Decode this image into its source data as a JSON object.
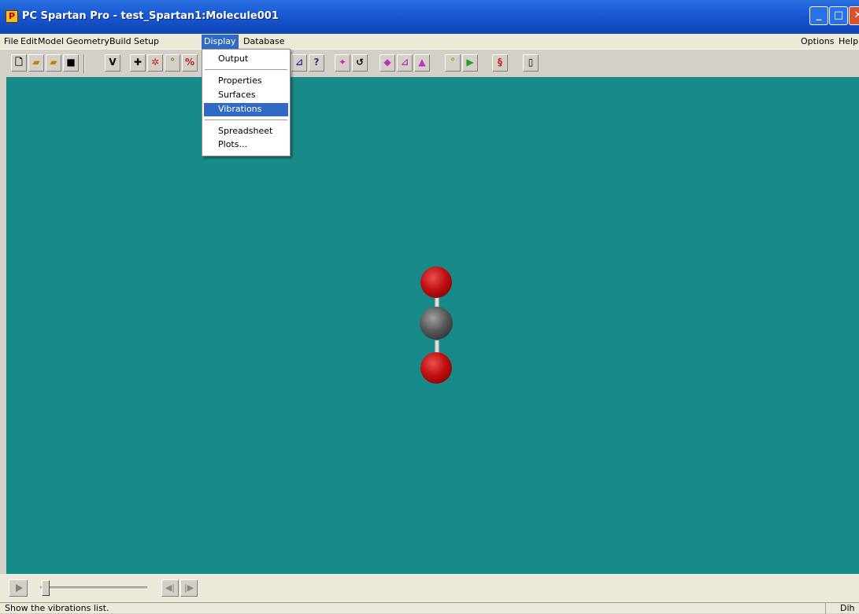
{
  "window": {
    "app_icon": "spartan-logo-icon",
    "title": "PC Spartan Pro - test_Spartan1:Molecule001",
    "minimize_icon": "minimize-icon",
    "maximize_icon": "maximize-icon",
    "close_icon": "close-icon"
  },
  "menubar": {
    "items": [
      "File",
      "Edit",
      "Model",
      "Geometry",
      "Build",
      "Setup",
      "Display",
      "Database"
    ],
    "right_items": [
      "Options",
      "Help"
    ],
    "active": "Display"
  },
  "toolbar": {
    "groups": [
      [
        "new-file-icon",
        "open-file-icon",
        "open-folder-icon",
        "save-icon"
      ],
      [
        "view-icon",
        "add-fragment-icon",
        "delete-icon",
        "make-bond-icon",
        "break-bond-icon"
      ],
      [
        "measure-distance-icon",
        "measure-angle-icon",
        "measure-dihedral-icon",
        "constrain-icon",
        "query-icon"
      ],
      [
        "center-icon",
        "rotate-icon"
      ],
      [
        "symmetry-icon",
        "freeze-icon",
        "set-torsion-icon"
      ],
      [
        "chain-icon",
        "transition-state-icon"
      ],
      [
        "conformer-icon"
      ],
      [
        "cylinder-icon"
      ]
    ]
  },
  "display_menu": {
    "items": [
      "Output",
      "Properties",
      "Surfaces",
      "Vibrations",
      "Spreadsheet",
      "Plots..."
    ],
    "selected": "Vibrations"
  },
  "viewport": {
    "background": "#198a8a",
    "atoms": [
      {
        "element": "O",
        "color": "#c21010"
      },
      {
        "element": "C",
        "color": "#5a5a5a"
      },
      {
        "element": "O",
        "color": "#c21010"
      }
    ]
  },
  "animation": {
    "play_icon": "play-icon",
    "step_back_icon": "step-back-icon",
    "step_forward_icon": "step-forward-icon"
  },
  "status": {
    "message": "Show the vibrations list.",
    "point_group": "Dih"
  }
}
